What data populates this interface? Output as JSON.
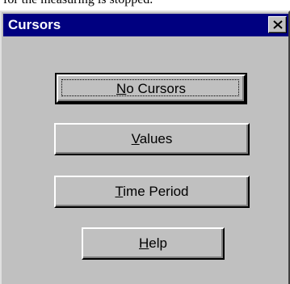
{
  "background_text": "for the measuring is stopped.",
  "window": {
    "title": "Cursors",
    "close_label": "Close"
  },
  "buttons": [
    {
      "key": "N",
      "rest": "o Cursors",
      "full": "No Cursors",
      "default": true
    },
    {
      "key": "V",
      "rest": "alues",
      "full": "Values",
      "default": false
    },
    {
      "key": "T",
      "rest": "ime Period",
      "full": "Time Period",
      "default": false
    },
    {
      "key": "H",
      "rest": "elp",
      "full": "Help",
      "default": false
    }
  ],
  "colors": {
    "titlebar": "#000080",
    "face": "#c0c0c0"
  }
}
